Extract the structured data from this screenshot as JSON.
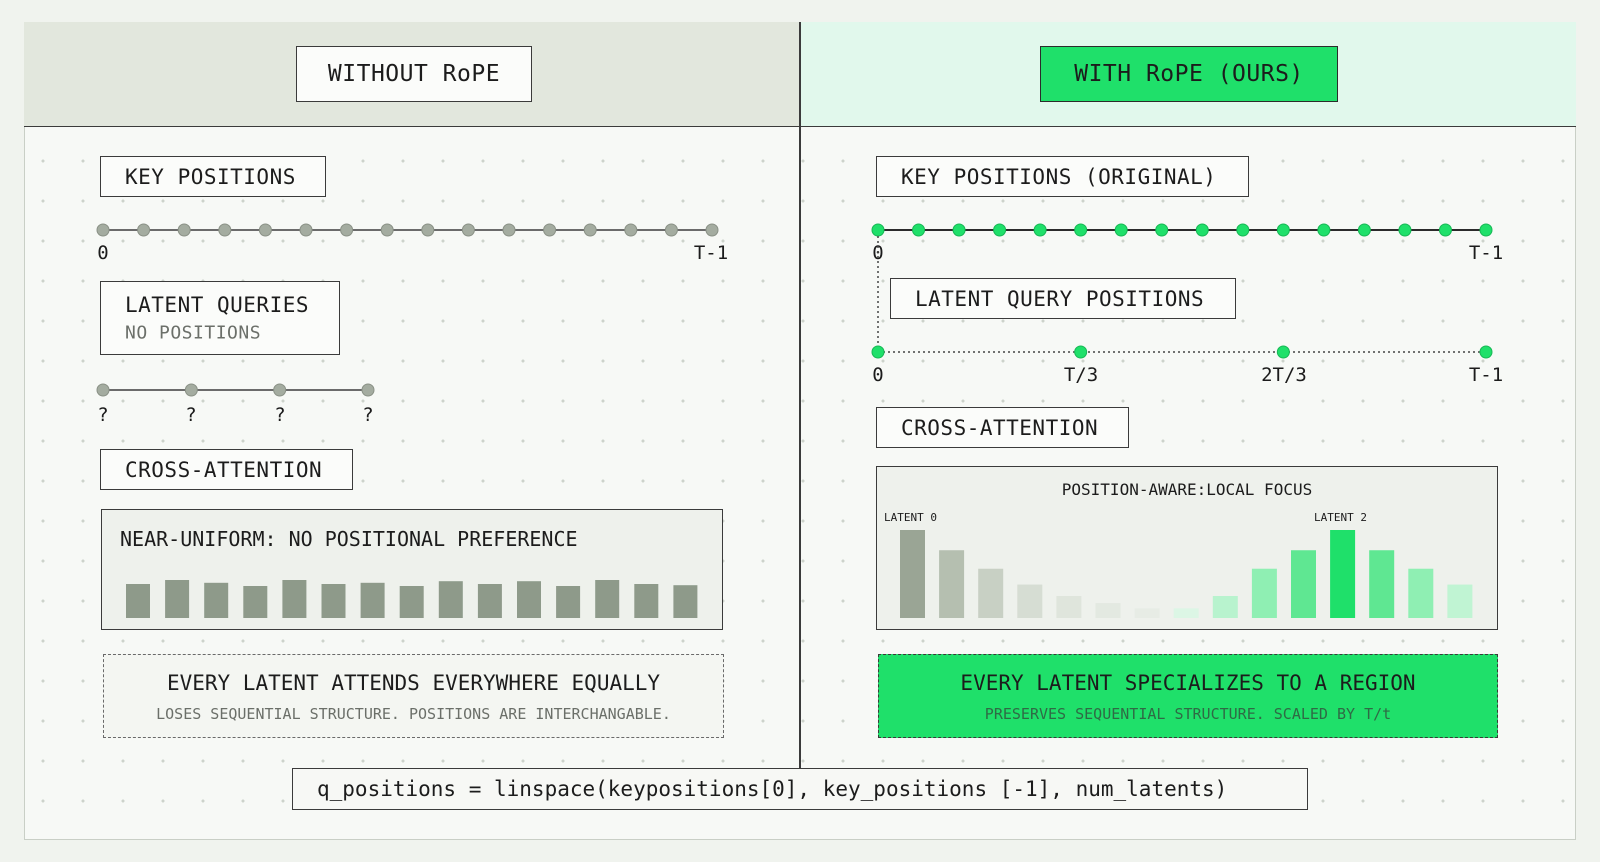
{
  "left": {
    "title": "WITHOUT RoPE",
    "key_positions_label": "KEY POSITIONS",
    "key_start": "0",
    "key_end": "T-1",
    "latent_queries_label": "LATENT QUERIES",
    "latent_queries_sub": "NO POSITIONS",
    "latent_labels": [
      "?",
      "?",
      "?",
      "?"
    ],
    "cross_attention_label": "CROSS-ATTENTION",
    "chart_title": "NEAR-UNIFORM: NO POSITIONAL PREFERENCE",
    "summary_title": "EVERY LATENT ATTENDS EVERYWHERE EQUALLY",
    "summary_sub": "LOSES SEQUENTIAL STRUCTURE. POSITIONS ARE INTERCHANGABLE."
  },
  "right": {
    "title": "WITH RoPE (OURS)",
    "key_positions_label": "KEY POSITIONS (ORIGINAL)",
    "key_start": "0",
    "key_end": "T-1",
    "latent_query_label": "LATENT QUERY POSITIONS",
    "query_ticks": [
      "0",
      "T/3",
      "2T/3",
      "T-1"
    ],
    "cross_attention_label": "CROSS-ATTENTION",
    "chart_title": "POSITION-AWARE:LOCAL FOCUS",
    "chart_label_a": "LATENT 0",
    "chart_label_b": "LATENT 2",
    "summary_title": "EVERY LATENT SPECIALIZES TO A REGION",
    "summary_sub": "PRESERVES SEQUENTIAL STRUCTURE. SCALED BY T/t"
  },
  "code": "q_positions = linspace(keypositions[0], key_positions [-1], num_latents)",
  "chart_data": [
    {
      "type": "bar",
      "title": "NEAR-UNIFORM: NO POSITIONAL PREFERENCE",
      "values": [
        0.85,
        0.95,
        0.88,
        0.8,
        0.95,
        0.85,
        0.88,
        0.8,
        0.92,
        0.85,
        0.92,
        0.8,
        0.95,
        0.85,
        0.82
      ],
      "color": "#8e9a8a"
    },
    {
      "type": "bar",
      "title": "POSITION-AWARE:LOCAL FOCUS",
      "values": [
        1.0,
        0.77,
        0.56,
        0.38,
        0.25,
        0.17,
        0.11,
        0.11,
        0.25,
        0.56,
        0.77,
        1.0,
        0.77,
        0.56,
        0.38
      ],
      "colors": [
        "#9aa595",
        "#b5bfb0",
        "#c8d0c4",
        "#d6ddd3",
        "#dfe5dc",
        "#e3e9e1",
        "#e7ece5",
        "#dcf6e5",
        "#b8f3ce",
        "#8fefb3",
        "#5fe792",
        "#1fe06a",
        "#5fe792",
        "#8fefb3",
        "#c0f4d3"
      ]
    }
  ],
  "colors": {
    "accent_green": "#1fe06a",
    "grey_dot": "#a4aca0",
    "header_left": "#e2e7dd",
    "header_right": "#e1f8ec"
  }
}
